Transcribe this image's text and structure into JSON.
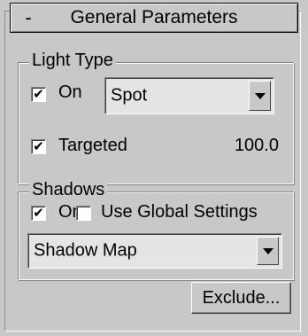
{
  "rollout": {
    "collapse_symbol": "-",
    "title": "General Parameters"
  },
  "light_type": {
    "label": "Light Type",
    "on_label": "On",
    "on_checked": true,
    "type_value": "Spot",
    "targeted_label": "Targeted",
    "targeted_checked": true,
    "target_distance": "100.0"
  },
  "shadows": {
    "label": "Shadows",
    "on_label": "On",
    "on_checked": true,
    "use_global_label": "Use Global Settings",
    "use_global_checked": false,
    "type_value": "Shadow Map"
  },
  "exclude_label": "Exclude...",
  "icons": {
    "checkmark": "checkmark-icon",
    "dropdown": "dropdown-arrow-icon"
  }
}
